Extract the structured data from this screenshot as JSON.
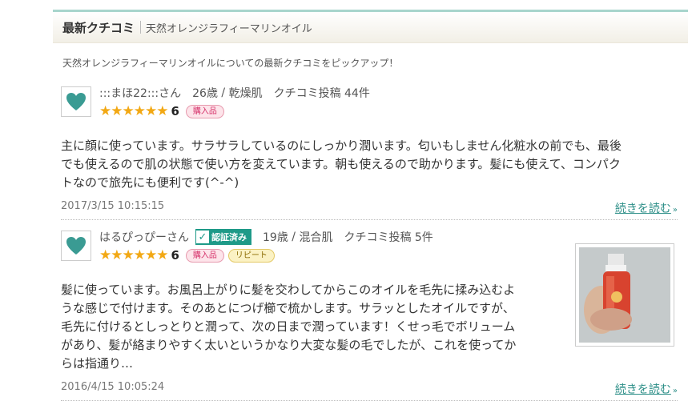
{
  "section": {
    "title": "最新クチコミ",
    "subtitle": "天然オレンジラフィーマリンオイル",
    "intro": "天然オレンジラフィーマリンオイルについての最新クチコミをピックアップ！"
  },
  "reviews": [
    {
      "user": ":::まほ22:::さん",
      "age": "26歳",
      "skin": "乾燥肌",
      "posts": "クチコミ投稿 44件",
      "stars": "★★★★★★",
      "score": "6",
      "badge_buy": "購入品",
      "lines": [
        "主に顔に使っています。サラサラしているのにしっかり潤います。匂いもしません化粧水の前でも、最後",
        "でも使えるので肌の状態で使い方を変えています。朝も使えるので助かります。髪にも使えて、コンパク",
        "トなので旅先にも便利です(^-^)"
      ],
      "date": "2017/3/15 10:15:15",
      "more": "続きを読む"
    },
    {
      "user": "はるぴっぴーさん",
      "verified": "認証済み",
      "age": "19歳",
      "skin": "混合肌",
      "posts": "クチコミ投稿 5件",
      "stars": "★★★★★★",
      "score": "6",
      "badge_buy": "購入品",
      "badge_repeat": "リピート",
      "lines": [
        "髪に使っています。お風呂上がりに髪を交わしてからこのオイルを毛先に揉み込むよ",
        "うな感じで付けます。そのあとにつげ櫛で梳かします。サラッとしたオイルですが、",
        "毛先に付けるとしっとりと潤って、次の日まで潤っています！くせっ毛でボリューム",
        "があり、髪が絡まりやすく太いというかなり大変な髪の毛でしたが、これを使ってか",
        "らは指通り…"
      ],
      "date": "2016/4/15 10:05:24",
      "more": "続きを読む"
    }
  ]
}
